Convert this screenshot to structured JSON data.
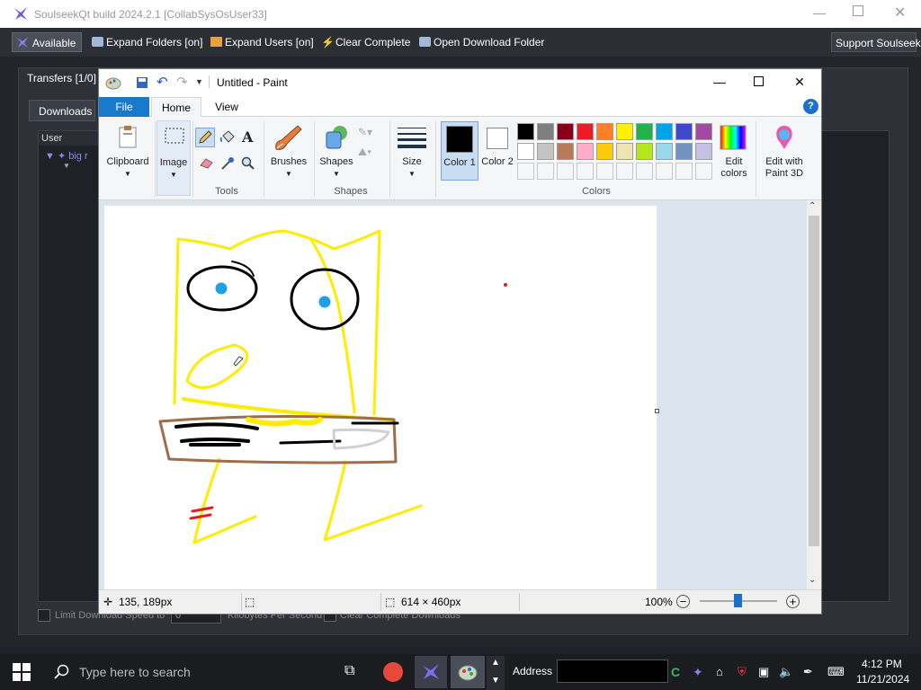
{
  "soulseek": {
    "title": "SoulseekQt build 2024.2.1 [CollabSysOsUser33]",
    "toolbar": {
      "available": "Available",
      "expand_folders": "Expand Folders [on]",
      "expand_users": "Expand Users [on]",
      "clear_complete": "Clear Complete",
      "open_download_folder": "Open Download Folder",
      "support": "Support Soulseek!"
    },
    "transfers_tab": "Transfers [1/0]",
    "downloads_tab": "Downloads",
    "table_header_user": "User",
    "row_user": "big r",
    "bottom": {
      "limit_speed": "Limit Download Speed to",
      "speed_value": "0",
      "unit": "Kilobytes Per Second",
      "clear_complete": "Clear Complete Downloads"
    }
  },
  "paint": {
    "title": "Untitled - Paint",
    "tabs": {
      "file": "File",
      "home": "Home",
      "view": "View"
    },
    "ribbon": {
      "clipboard": "Clipboard",
      "image": "Image",
      "tools": "Tools",
      "brushes": "Brushes",
      "shapes_btn": "Shapes",
      "shapes_group": "Shapes",
      "size": "Size",
      "color1": "Color 1",
      "color2": "Color 2",
      "colors_group": "Colors",
      "edit_colors": "Edit colors",
      "edit_paint3d": "Edit with Paint 3D"
    },
    "palette_row1": [
      "#000000",
      "#7f7f7f",
      "#880015",
      "#ed1c24",
      "#ff7f27",
      "#fff200",
      "#22b14c",
      "#00a2e8",
      "#3f48cc",
      "#a349a4"
    ],
    "palette_row2": [
      "#ffffff",
      "#c3c3c3",
      "#b97a57",
      "#ffaec9",
      "#ffc90e",
      "#efe4b0",
      "#b5e61d",
      "#99d9ea",
      "#7092be",
      "#c8bfe7"
    ],
    "status": {
      "cursor_pos": "135, 189px",
      "canvas_size": "614 × 460px",
      "zoom": "100%"
    }
  },
  "taskbar": {
    "search_placeholder": "Type here to search",
    "address_label": "Address",
    "time": "4:12 PM",
    "date": "11/21/2024"
  }
}
